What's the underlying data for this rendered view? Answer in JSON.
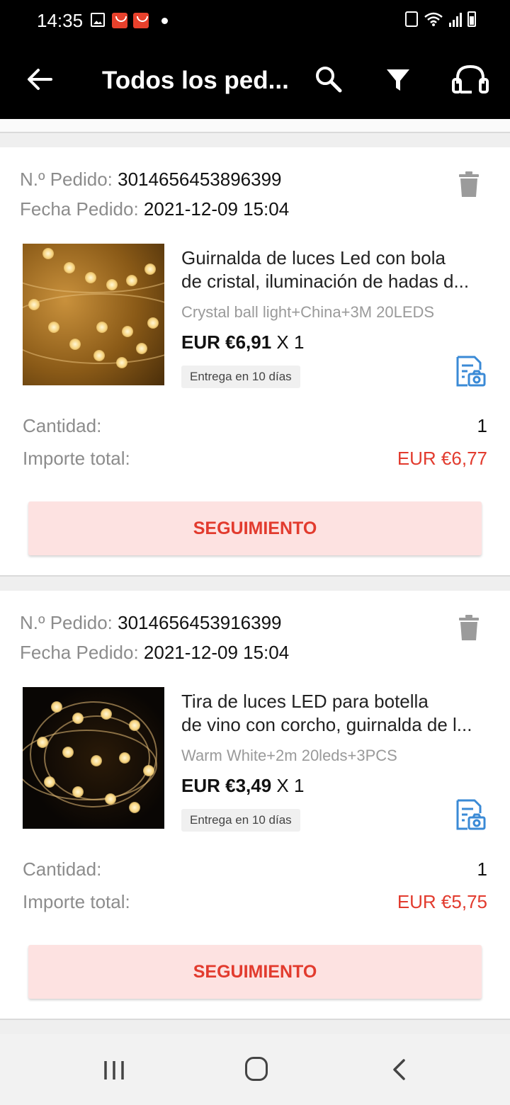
{
  "status_bar": {
    "time": "14:35",
    "icons": [
      "gallery-icon",
      "aliexpress-icon",
      "aliexpress-icon",
      "notification-dot",
      "lock-icon",
      "wifi-icon",
      "signal-icon",
      "battery-icon"
    ]
  },
  "app_bar": {
    "title": "Todos los ped...",
    "actions": [
      "search-icon",
      "filter-icon",
      "headset-icon"
    ]
  },
  "orders": [
    {
      "order_id_label": "N.º Pedido:",
      "order_id": "3014656453896399",
      "order_date_label": "Fecha Pedido:",
      "order_date": "2021-12-09 15:04",
      "product_name_line1": "Guirnalda de luces Led con bola",
      "product_name_line2": "de cristal, iluminación de hadas d...",
      "variant": "Crystal ball light+China+3M 20LEDS",
      "price": "EUR €6,91",
      "multiplier": "X 1",
      "delivery_badge": "Entrega en 10 días",
      "quantity_label": "Cantidad:",
      "quantity": "1",
      "total_label": "Importe total:",
      "total": "EUR €6,77",
      "tracking_button": "SEGUIMIENTO"
    },
    {
      "order_id_label": "N.º Pedido:",
      "order_id": "3014656453916399",
      "order_date_label": "Fecha Pedido:",
      "order_date": "2021-12-09 15:04",
      "product_name_line1": "Tira de luces LED para botella",
      "product_name_line2": "de vino con corcho, guirnalda de l...",
      "variant": "Warm White+2m 20leds+3PCS",
      "price": "EUR €3,49",
      "multiplier": "X 1",
      "delivery_badge": "Entrega en 10 días",
      "quantity_label": "Cantidad:",
      "quantity": "1",
      "total_label": "Importe total:",
      "total": "EUR €5,75",
      "tracking_button": "SEGUIMIENTO"
    }
  ],
  "colors": {
    "accent_red": "#e23b2e",
    "button_bg": "#fde2e1",
    "app_bar_bg": "#000000",
    "muted_text": "#8c8c8c",
    "icon_blue": "#3a8ad6"
  }
}
